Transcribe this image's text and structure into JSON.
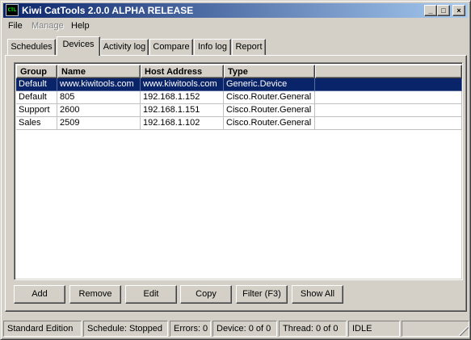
{
  "window": {
    "title": "Kiwi CatTools 2.0.0 ALPHA RELEASE",
    "icon_text": "CTL",
    "icon": "cattools-app-icon",
    "controls": {
      "minimize": "_",
      "maximize": "□",
      "close": "×"
    }
  },
  "menu": [
    {
      "label": "File",
      "enabled": true
    },
    {
      "label": "Manage",
      "enabled": false
    },
    {
      "label": "Help",
      "enabled": true
    }
  ],
  "tabs": [
    {
      "label": "Schedules",
      "active": false
    },
    {
      "label": "Devices",
      "active": true
    },
    {
      "label": "Activity log",
      "active": false
    },
    {
      "label": "Compare",
      "active": false
    },
    {
      "label": "Info log",
      "active": false
    },
    {
      "label": "Report",
      "active": false
    }
  ],
  "devices": {
    "columns": [
      "Group",
      "Name",
      "Host Address",
      "Type",
      ""
    ],
    "rows": [
      {
        "cells": [
          "Default",
          "www.kiwitools.com",
          "www.kiwitools.com",
          "Generic.Device",
          ""
        ],
        "selected": true
      },
      {
        "cells": [
          "Default",
          "805",
          "192.168.1.152",
          "Cisco.Router.General",
          ""
        ],
        "selected": false
      },
      {
        "cells": [
          "Support",
          "2600",
          "192.168.1.151",
          "Cisco.Router.General",
          ""
        ],
        "selected": false
      },
      {
        "cells": [
          "Sales",
          "2509",
          "192.168.1.102",
          "Cisco.Router.General",
          ""
        ],
        "selected": false
      }
    ]
  },
  "buttons": {
    "add": "Add",
    "remove": "Remove",
    "edit": "Edit",
    "copy": "Copy",
    "filter": "Filter (F3)",
    "show_all": "Show All"
  },
  "status": {
    "edition": "Standard Edition",
    "schedule": "Schedule: Stopped",
    "errors": "Errors: 0",
    "device": "Device: 0 of 0",
    "thread": "Thread: 0 of 0",
    "state": "IDLE"
  },
  "colors": {
    "selection": "#0a246a",
    "titlebar_start": "#0a246a",
    "titlebar_end": "#a6caf0",
    "face": "#d4d0c8"
  }
}
